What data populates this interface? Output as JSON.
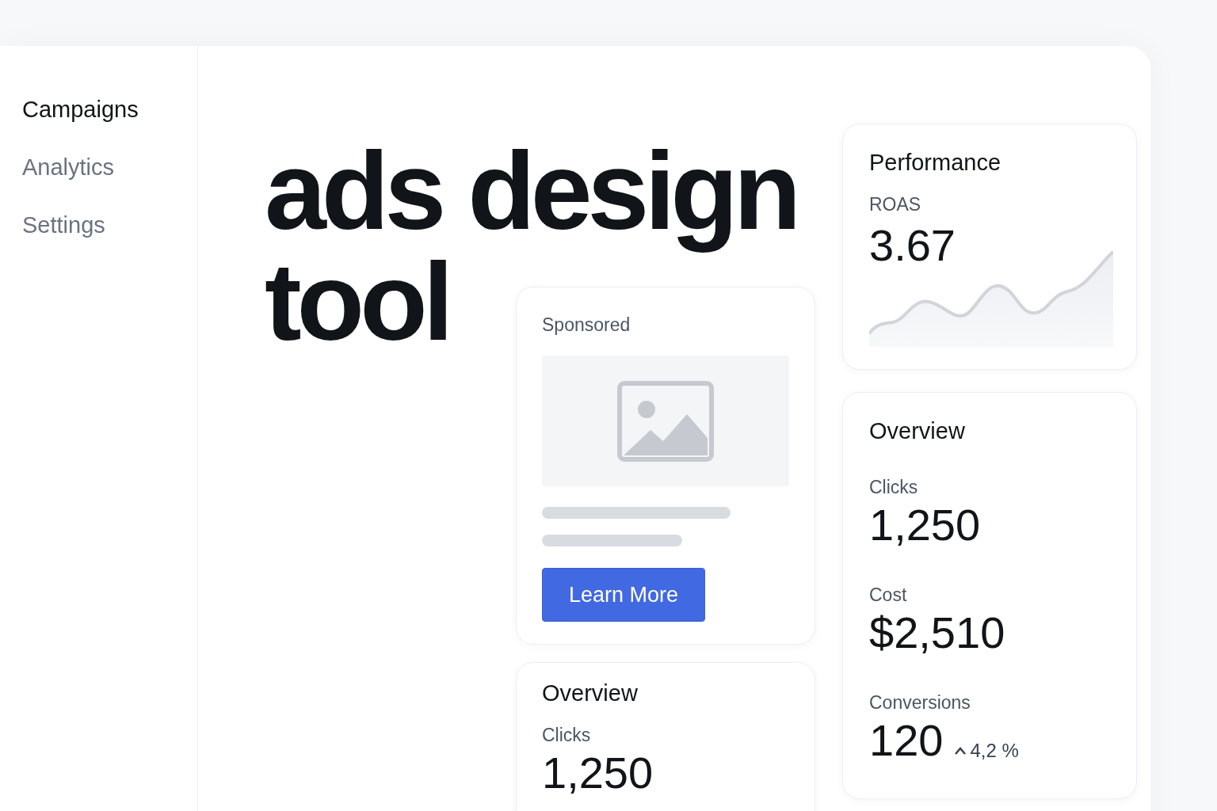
{
  "sidebar": {
    "items": [
      {
        "label": "Campaigns",
        "selected": true
      },
      {
        "label": "Analytics",
        "selected": false
      },
      {
        "label": "Settings",
        "selected": false
      }
    ]
  },
  "title_lines": [
    "ads design",
    "tool"
  ],
  "ad_card": {
    "label": "Sponsored",
    "button": "Learn More"
  },
  "overview_bottom": {
    "title": "Overview",
    "metrics": [
      {
        "label": "Clicks",
        "value": "1,250"
      }
    ]
  },
  "performance": {
    "title": "Performance",
    "metric_label": "ROAS",
    "metric_value": "3.67"
  },
  "overview": {
    "title": "Overview",
    "metrics": [
      {
        "label": "Clicks",
        "value": "1,250"
      },
      {
        "label": "Cost",
        "value": "$2,510"
      },
      {
        "label": "Conversions",
        "value": "120",
        "change": "4,2 %"
      }
    ]
  }
}
